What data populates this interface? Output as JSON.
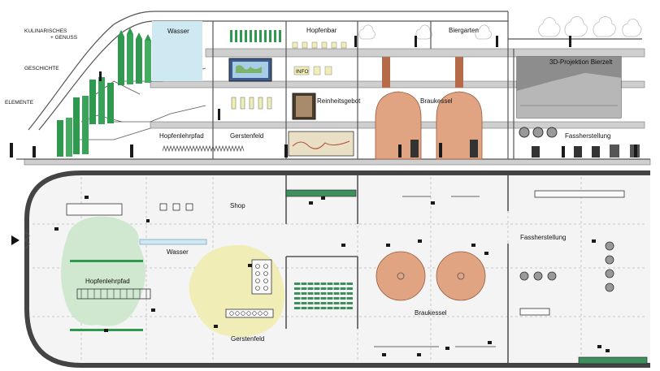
{
  "section": {
    "side_labels": [
      "KULINARISCHES",
      "+ GENUSS",
      "GESCHICHTE",
      "ELEMENTE"
    ],
    "rooms": {
      "wasser": "Wasser",
      "hopfenbar": "Hopfenbar",
      "biergarten": "Biergarten",
      "projektion": "3D-Projektion Bierzelt",
      "reinheitsgebot": "Reinheitsgebot",
      "braukessel": "Braukessel",
      "hopfenlehrpfad": "Hopfenlehrpfad",
      "gerstenfeld": "Gerstenfeld",
      "fassherstellung": "Fassherstellung"
    },
    "info_sign": "INFO"
  },
  "plan": {
    "labels": {
      "shop": "Shop",
      "wasser": "Wasser",
      "hopfenlehrpfad": "Hopfenlehrpfad",
      "gerstenfeld": "Gerstenfeld",
      "braukessel": "Braukessel",
      "fassherstellung": "Fassherstellung"
    }
  },
  "colors": {
    "water": "#cfe9f2",
    "hops_green": "#2f9a4f",
    "hops_zone": "#cfe8cf",
    "barley_zone": "#f1edb6",
    "kettle": "#e0a483",
    "floor_fill": "#f4f4f4"
  }
}
